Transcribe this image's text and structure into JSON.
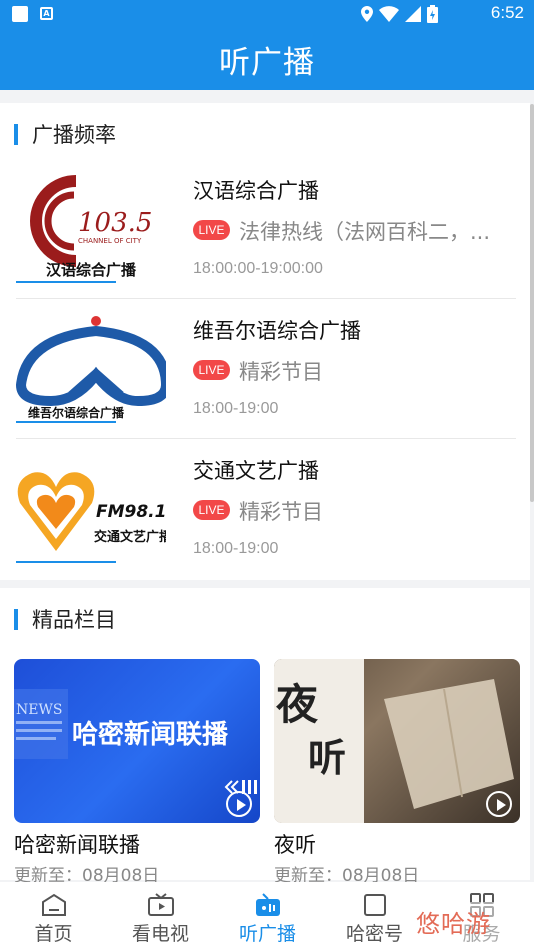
{
  "status_bar": {
    "time": "6:52",
    "notif_icon": "A"
  },
  "header": {
    "title": "听广播"
  },
  "frequency_section": {
    "title": "广播频率",
    "stations": [
      {
        "name": "汉语综合广播",
        "live": "LIVE",
        "program": "法律热线（法网百科二，...",
        "time": "18:00:00-19:00:00",
        "logo_text": "汉语综合广播",
        "logo_freq": "103.5",
        "logo_sub": "CHANNEL OF CITY"
      },
      {
        "name": "维吾尔语综合广播",
        "live": "LIVE",
        "program": "精彩节目",
        "time": "18:00-19:00",
        "logo_text": "维吾尔语综合广播"
      },
      {
        "name": "交通文艺广播",
        "live": "LIVE",
        "program": "精彩节目",
        "time": "18:00-19:00",
        "logo_text": "交通文艺广播",
        "logo_freq": "FM98.1"
      }
    ]
  },
  "featured_section": {
    "title": "精品栏目",
    "cards": [
      {
        "name": "哈密新闻联播",
        "updated": "更新至：08月08日",
        "thumb_text": "哈密新闻联播",
        "thumb_tag": "NEWS"
      },
      {
        "name": "夜听",
        "updated": "更新至：08月08日",
        "thumb_text_1": "夜",
        "thumb_text_2": "听"
      }
    ]
  },
  "tabbar": {
    "tabs": [
      {
        "label": "首页",
        "icon": "home-icon"
      },
      {
        "label": "看电视",
        "icon": "tv-icon"
      },
      {
        "label": "听广播",
        "icon": "radio-icon"
      },
      {
        "label": "哈密号",
        "icon": "account-icon"
      },
      {
        "label": "服务",
        "icon": "service-grid-icon"
      }
    ],
    "active_index": 2
  },
  "watermark": {
    "text": "悠哈游"
  },
  "colors": {
    "primary": "#1a8ee8",
    "live": "#f24848",
    "watermark": "#e36b56"
  }
}
